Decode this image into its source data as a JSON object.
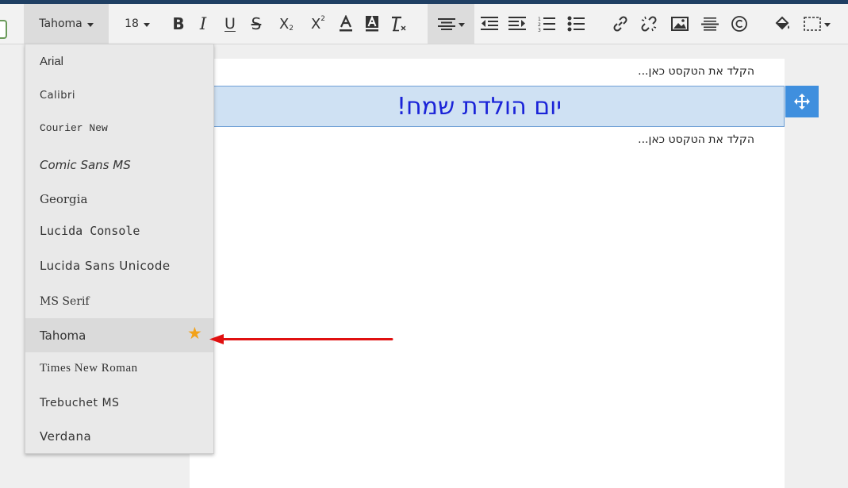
{
  "toolbar": {
    "font_family": "Tahoma",
    "font_size": "18",
    "bold_label": "B",
    "italic_label": "I",
    "underline_label": "U",
    "strike_label": "S",
    "subscript_label": "X",
    "subscript_mark": "2",
    "superscript_label": "X",
    "superscript_mark": "2"
  },
  "fonts": [
    {
      "label": "Arial"
    },
    {
      "label": "Calibri"
    },
    {
      "label": "Courier New"
    },
    {
      "label": "Comic Sans MS"
    },
    {
      "label": "Georgia"
    },
    {
      "label": "Lucida Console"
    },
    {
      "label": "Lucida Sans Unicode"
    },
    {
      "label": "MS Serif"
    },
    {
      "label": "Tahoma"
    },
    {
      "label": "Times New Roman"
    },
    {
      "label": "Trebuchet MS"
    },
    {
      "label": "Verdana"
    }
  ],
  "selected_font": "Tahoma",
  "document": {
    "placeholder_top": "הקלד את הטקסט כאן...",
    "heading": "יום הולדת שמח!",
    "placeholder_bottom": "הקלד את הטקסט כאן..."
  },
  "colors": {
    "accent_blue": "#3f8fde",
    "heading_text": "#1a23d8",
    "heading_bg": "#cfe1f3",
    "star": "#f2a21a",
    "arrow": "#e01010",
    "top_strip": "#1f3f63"
  }
}
